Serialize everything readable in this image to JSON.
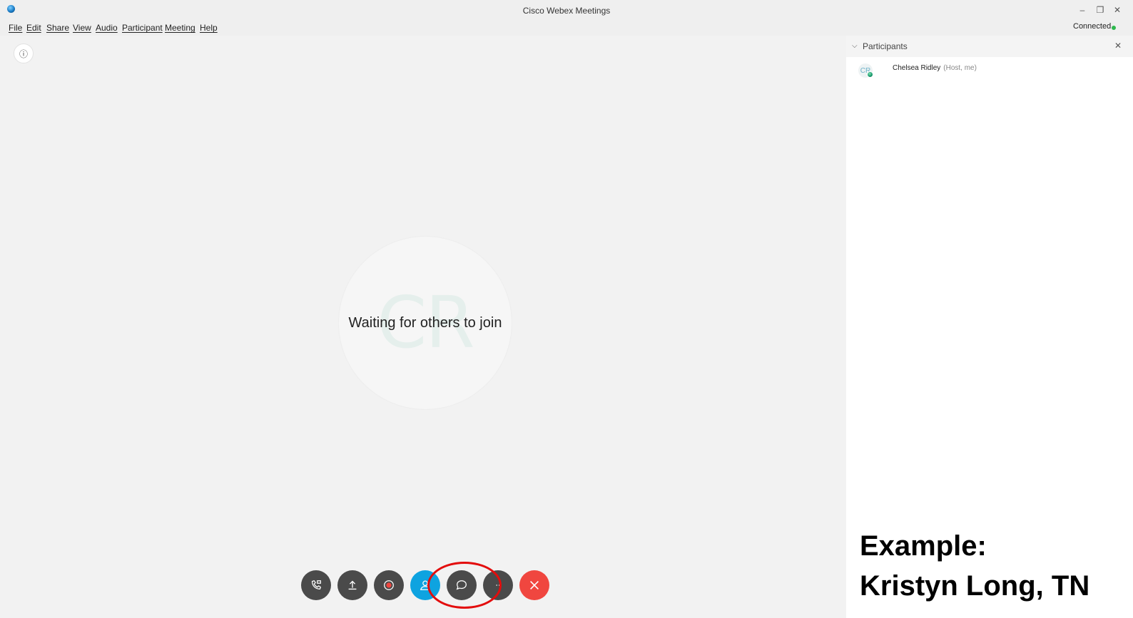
{
  "window": {
    "title": "Cisco Webex Meetings",
    "controls": {
      "minimize": "–",
      "maximize": "❐",
      "close": "✕"
    }
  },
  "menu": {
    "items": [
      "File",
      "Edit",
      "Share",
      "View",
      "Audio",
      "Participant",
      "Meeting",
      "Help"
    ]
  },
  "status": {
    "connection_label": "Connected",
    "connection_color": "#2db84d"
  },
  "stage": {
    "avatar_initials": "CR",
    "waiting_message": "Waiting for others to join",
    "info_icon": "ⓘ"
  },
  "controls": [
    {
      "name": "audio-button",
      "icon": "phone-icon"
    },
    {
      "name": "share-button",
      "icon": "upload-icon"
    },
    {
      "name": "record-button",
      "icon": "record-icon"
    },
    {
      "name": "participants-button",
      "icon": "person-icon",
      "active": true,
      "color": "#0ea3e0"
    },
    {
      "name": "chat-button",
      "icon": "chat-bubble-icon",
      "highlighted": true
    },
    {
      "name": "more-options-button",
      "icon": "ellipsis-icon",
      "label": "..."
    },
    {
      "name": "end-meeting-button",
      "icon": "close-icon",
      "color": "#f0463f"
    }
  ],
  "participants_panel": {
    "title": "Participants",
    "close_icon": "✕",
    "participants": [
      {
        "initials": "CR",
        "name": "Chelsea Ridley",
        "role": "(Host, me)"
      }
    ]
  },
  "overlay": {
    "line1": "Example:",
    "line2": "Kristyn Long, TN",
    "highlight_color": "#e30d0d"
  }
}
